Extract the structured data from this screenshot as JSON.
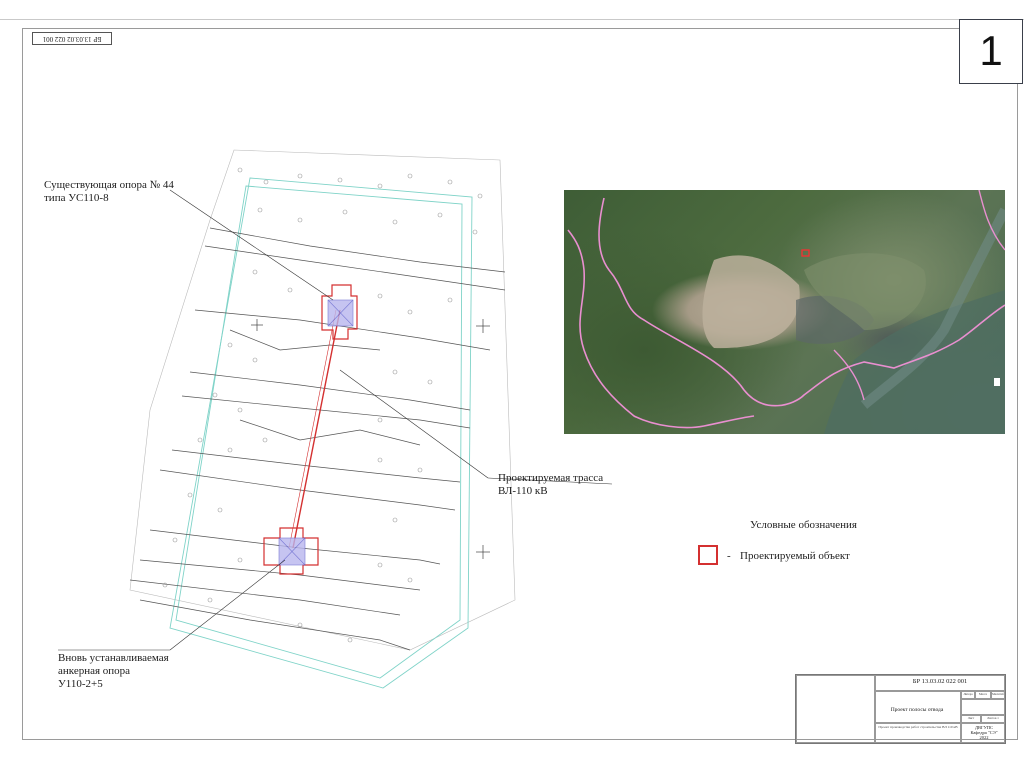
{
  "slide_number": "1",
  "stamp_top": "БР 13.03.02 022 001",
  "labels": {
    "existing_pole_line1": "Существующая опора № 44",
    "existing_pole_line2": "типа УС110-8",
    "route_line1": "Проектируемая трасса",
    "route_line2": "ВЛ-110 кВ",
    "new_pole_line1": "Вновь устанавливаемая",
    "new_pole_line2": "анкерная опора",
    "new_pole_line3": "У110-2+5"
  },
  "legend": {
    "title": "Условные обозначения",
    "dash": "-",
    "item": "Проектируемый объект",
    "item_color": "#d43030"
  },
  "title_block": {
    "code": "БР 13.03.02 022 001",
    "name": "Проект полосы отвода",
    "description": "Проект производства работ строительства ВЛ 110 кВ",
    "org_line1": "ДВГУПС",
    "org_line2": "Кафедра \"СЭ\"",
    "org_year": "2022",
    "stage_header": "Литера",
    "mass_header": "Масса",
    "scale_header": "Масштаб",
    "sheet_label": "Лист",
    "sheets_label": "Листов 1"
  },
  "colors": {
    "route": "#d43030",
    "boundary": "#7fd3c8",
    "map_boundary": "#e98fd0"
  }
}
